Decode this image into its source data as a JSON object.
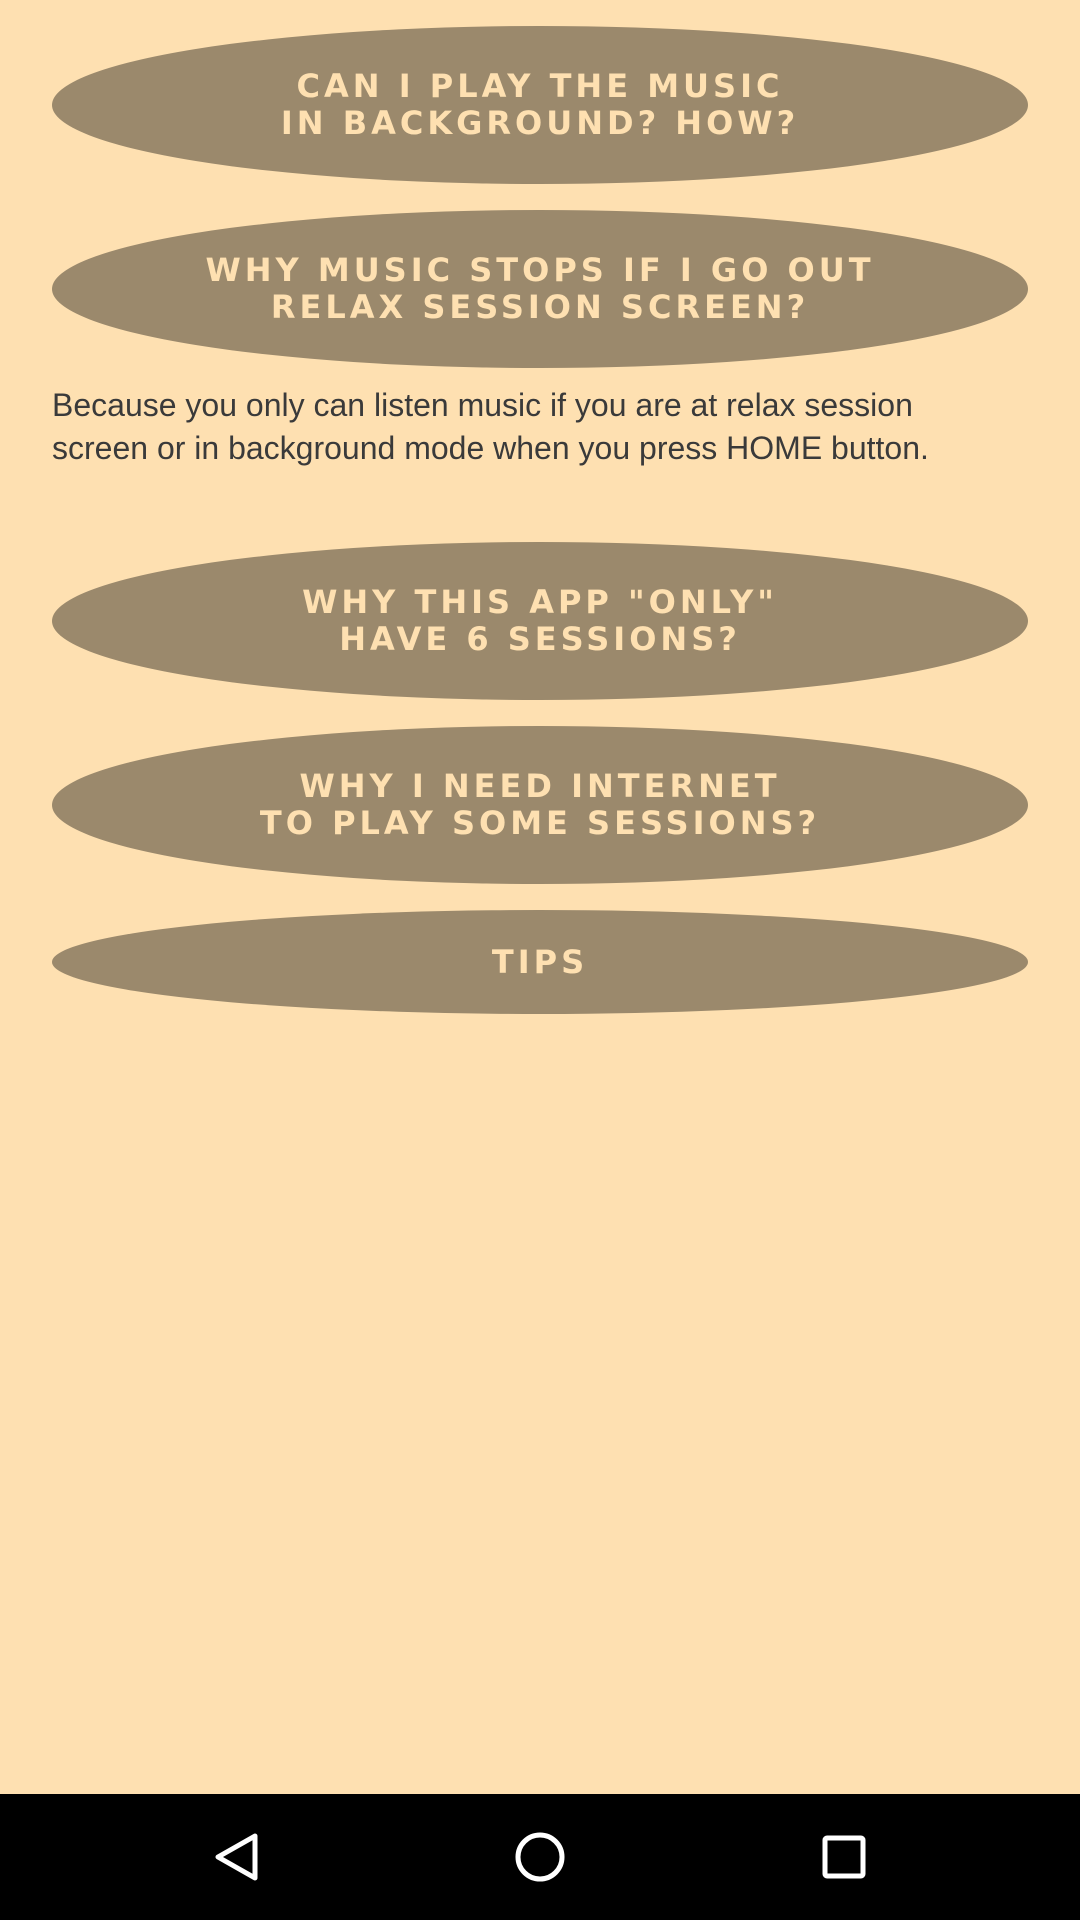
{
  "faq": {
    "q1": "Can i play the music\nin background? How?",
    "q2": "Why music stops if i go out\nrelax session screen?",
    "answer2": "Because you only can listen music if you are at relax session screen or in background mode when you press HOME button.",
    "q3": "Why this app \"only\"\nhave 6 sessions?",
    "q4": "Why i need internet\nto play some sessions?",
    "q5": "Tips"
  },
  "colors": {
    "background": "#FEE0B1",
    "button": "#9B896C",
    "button_text": "#FEE0B1",
    "answer_text": "#3A3A3A",
    "navbar": "#000000"
  },
  "navbar": {
    "back_icon": "back-triangle-icon",
    "home_icon": "home-circle-icon",
    "recents_icon": "recents-square-icon"
  }
}
